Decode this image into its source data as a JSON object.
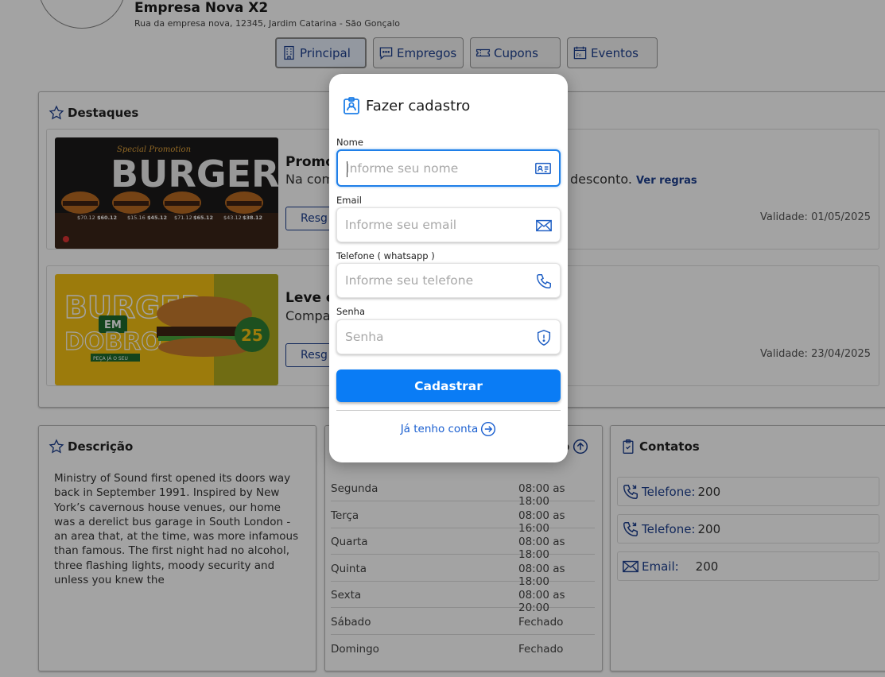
{
  "header": {
    "company_name": "Empresa Nova X2",
    "address": "Rua da empresa nova, 12345, Jardim Catarina -  São Gonçalo"
  },
  "tabs": [
    {
      "label": "Principal",
      "icon": "building-icon",
      "active": true
    },
    {
      "label": "Empregos",
      "icon": "chat-icon",
      "active": false
    },
    {
      "label": "Cupons",
      "icon": "ticket-icon",
      "active": false
    },
    {
      "label": "Eventos",
      "icon": "calendar-icon",
      "active": false
    }
  ],
  "destaques": {
    "title": "Destaques",
    "promos": [
      {
        "image_title_top": "Special Promotion",
        "image_title": "BURGER",
        "prices": [
          "$70.12",
          "$60.12",
          "$15.16",
          "$45.12",
          "$71.12",
          "$65.12",
          "$43.12",
          "$38.12"
        ],
        "title": "Promo",
        "description": "Na com",
        "description_end": "desconto.",
        "rules_link": "Ver regras",
        "button": "Resg",
        "validity": "Validade: 01/05/2025"
      },
      {
        "image_title": "BURGER",
        "image_badge": "EM",
        "image_subtitle": "DOBRO",
        "image_cta": "PEÇA JÁ O SEU",
        "image_price": "25",
        "title": "Leve e",
        "description": "Compa",
        "button": "Resg",
        "validity": "Validade: 23/04/2025"
      }
    ]
  },
  "descricao": {
    "title": "Descrição",
    "text": "Ministry of Sound first opened its doors way back in September 1991. Inspired by New York’s cavernous house venues, our home was a derelict bus garage in South London - an area that, at the time, was more infamous than famous. The first night had no alcohol, three flashing lights, moody security and unless you knew the"
  },
  "horarios": {
    "title_fragment": "o",
    "rows": [
      {
        "day": "Segunda",
        "time": "08:00 as 18:00"
      },
      {
        "day": "Terça",
        "time": "08:00 as 16:00"
      },
      {
        "day": "Quarta",
        "time": "08:00 as 18:00"
      },
      {
        "day": "Quinta",
        "time": "08:00 as 18:00"
      },
      {
        "day": "Sexta",
        "time": "08:00 as 20:00"
      },
      {
        "day": "Sábado",
        "time": "Fechado"
      },
      {
        "day": "Domingo",
        "time": "Fechado"
      }
    ]
  },
  "contatos": {
    "title": "Contatos",
    "items": [
      {
        "label": "Telefone:",
        "value": "200",
        "icon": "phone-icon"
      },
      {
        "label": "Telefone:",
        "value": "200",
        "icon": "phone-icon"
      },
      {
        "label": "Email:",
        "value": "200",
        "icon": "envelope-icon"
      }
    ]
  },
  "modal": {
    "title": "Fazer cadastro",
    "fields": [
      {
        "label": "Nome",
        "placeholder": "Informe seu nome",
        "icon": "id-card-icon",
        "focused": true
      },
      {
        "label": "Email",
        "placeholder": "Informe seu email",
        "icon": "envelope-icon",
        "focused": false
      },
      {
        "label": "Telefone ( whatsapp )",
        "placeholder": "Informe seu telefone",
        "icon": "phone-icon",
        "focused": false
      },
      {
        "label": "Senha",
        "placeholder": "Senha",
        "icon": "shield-icon",
        "focused": false
      }
    ],
    "submit": "Cadastrar",
    "login_link": "Já tenho conta"
  },
  "colors": {
    "accent": "#0a7cf5",
    "link": "#1d3f8f",
    "overlay": "rgba(0,0,0,0.36)"
  }
}
